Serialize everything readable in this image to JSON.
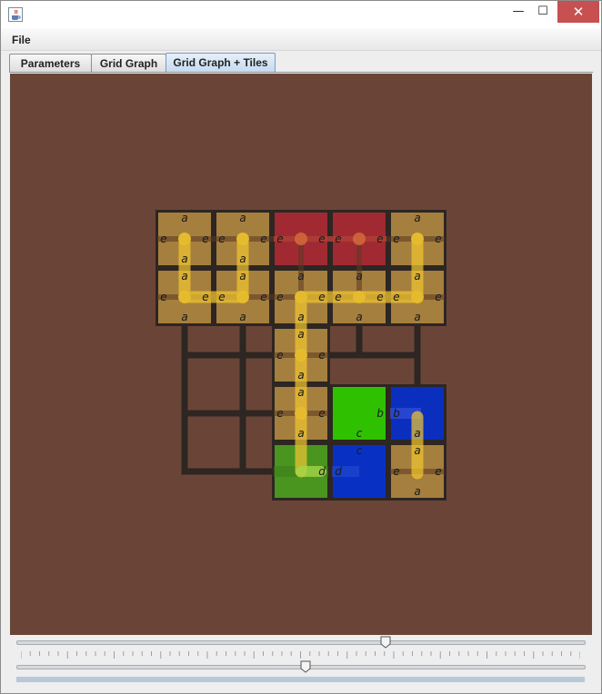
{
  "window": {
    "minimize_glyph": "—",
    "maximize_glyph": "☐",
    "close_glyph": "✕",
    "icon": "java-cup-icon"
  },
  "menu": {
    "file": "File"
  },
  "tabs": [
    {
      "label": "Parameters",
      "selected": false
    },
    {
      "label": "Grid Graph",
      "selected": false
    },
    {
      "label": "Grid Graph + Tiles",
      "selected": true
    }
  ],
  "colors": {
    "background": "#6a4537",
    "tile_tan": "#a57f3d",
    "tile_red": "#a12a32",
    "tile_green": "#2fc100",
    "tile_green_dark": "#4a9420",
    "tile_blue": "#0a2fbf",
    "tile_blue_mid": "#0831c4",
    "path_yellow": "#f0c530",
    "grid_dark": "#2d2622"
  },
  "tiles": [
    {
      "row": 0,
      "col": 0,
      "color": "tan",
      "labels": {
        "top": "a",
        "left": "e",
        "right": "e",
        "bottom": "a"
      }
    },
    {
      "row": 0,
      "col": 1,
      "color": "tan",
      "labels": {
        "top": "a",
        "left": "e",
        "right": "e",
        "bottom": "a"
      }
    },
    {
      "row": 0,
      "col": 2,
      "color": "red",
      "labels": {
        "left": "e",
        "right": "e"
      }
    },
    {
      "row": 0,
      "col": 3,
      "color": "red",
      "labels": {
        "left": "e",
        "right": "e"
      }
    },
    {
      "row": 0,
      "col": 4,
      "color": "tan",
      "labels": {
        "top": "a",
        "left": "e",
        "right": "e"
      }
    },
    {
      "row": 1,
      "col": 0,
      "color": "tan",
      "labels": {
        "top": "a",
        "left": "e",
        "right": "e",
        "bottom": "a"
      }
    },
    {
      "row": 1,
      "col": 1,
      "color": "tan",
      "labels": {
        "top": "a",
        "left": "e",
        "right": "e",
        "bottom": "a"
      }
    },
    {
      "row": 1,
      "col": 2,
      "color": "tan",
      "labels": {
        "top": "a",
        "left": "e",
        "right": "e",
        "bottom": "a"
      }
    },
    {
      "row": 1,
      "col": 3,
      "color": "tan",
      "labels": {
        "top": "a",
        "left": "e",
        "right": "e",
        "bottom": "a"
      }
    },
    {
      "row": 1,
      "col": 4,
      "color": "tan",
      "labels": {
        "top": "a",
        "left": "e",
        "right": "e",
        "bottom": "a"
      }
    },
    {
      "row": 2,
      "col": 2,
      "color": "tan",
      "labels": {
        "top": "a",
        "left": "e",
        "right": "e",
        "bottom": "a"
      }
    },
    {
      "row": 3,
      "col": 2,
      "color": "tan",
      "labels": {
        "top": "a",
        "left": "e",
        "right": "e",
        "bottom": "a"
      }
    },
    {
      "row": 3,
      "col": 3,
      "color": "green",
      "labels": {
        "right": "b",
        "bottom": "c"
      }
    },
    {
      "row": 3,
      "col": 4,
      "color": "blue",
      "labels": {
        "left": "b",
        "bottom": "a"
      }
    },
    {
      "row": 4,
      "col": 2,
      "color": "green_dark",
      "labels": {
        "right": "d"
      }
    },
    {
      "row": 4,
      "col": 3,
      "color": "blue_mid",
      "labels": {
        "top": "c",
        "left": "d"
      }
    },
    {
      "row": 4,
      "col": 4,
      "color": "tan",
      "labels": {
        "top": "a",
        "left": "e",
        "right": "e",
        "bottom": "a"
      }
    }
  ],
  "sliders": [
    {
      "name": "top-slider",
      "value": 0.65
    },
    {
      "name": "bottom-slider",
      "value": 0.51
    }
  ]
}
